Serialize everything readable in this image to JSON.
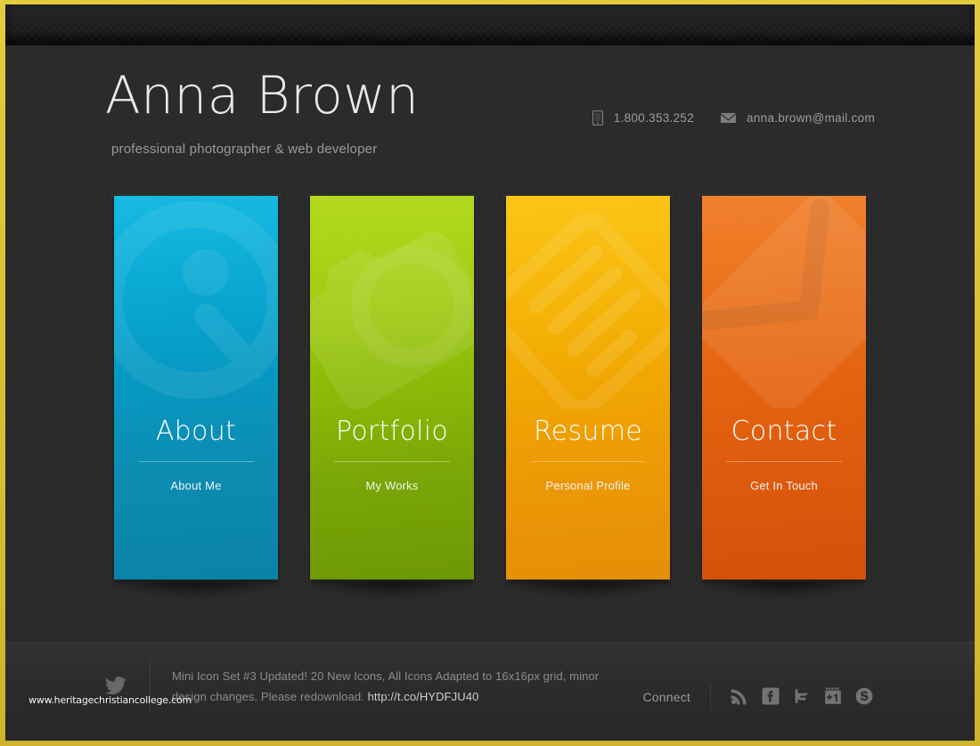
{
  "theme": {
    "frame_color": "#e0c63a",
    "page_bg": "#2b2b2b",
    "topbar_bg": "#1a1a1a",
    "footer_bg": "#2e2e2e"
  },
  "header": {
    "name": "Anna Brown",
    "tagline": "professional photographer & web developer",
    "contacts": [
      {
        "icon": "phone-icon",
        "text": "1.800.353.252"
      },
      {
        "icon": "mail-icon",
        "text": "anna.brown@mail.com"
      }
    ]
  },
  "cards": [
    {
      "title": "About",
      "subtitle": "About Me",
      "watermark_icon": "user-circle-icon",
      "color_top": "#00a8d8",
      "color_bottom": "#0a87ad",
      "accent": "#00a8d8"
    },
    {
      "title": "Portfolio",
      "subtitle": "My Works",
      "watermark_icon": "camera-icon",
      "color_top": "#a4cf09",
      "color_bottom": "#6f9a07",
      "accent": "#a4cf09"
    },
    {
      "title": "Resume",
      "subtitle": "Personal Profile",
      "watermark_icon": "document-lines-icon",
      "color_top": "#f5b400",
      "color_bottom": "#e8940b",
      "accent": "#f5b400"
    },
    {
      "title": "Contact",
      "subtitle": "Get In Touch",
      "watermark_icon": "envelope-icon",
      "color_top": "#ea6a12",
      "color_bottom": "#d8540c",
      "accent": "#ea6a12"
    }
  ],
  "footer": {
    "twitter_icon": "twitter-bird-icon",
    "tweet": "Mini Icon Set #3 Updated! 20 New Icons, All Icons Adapted to 16x16px grid, minor design changes. Please redownload. ",
    "tweet_link": "http://t.co/HYDFJU40",
    "connect_label": "Connect",
    "social": [
      {
        "name": "rss-icon",
        "label": "RSS"
      },
      {
        "name": "facebook-icon",
        "label": "Facebook"
      },
      {
        "name": "twitter-icon",
        "label": "Twitter"
      },
      {
        "name": "google-plus-one-icon",
        "label": "+1"
      },
      {
        "name": "skype-icon",
        "label": "Skype"
      }
    ]
  },
  "watermark": {
    "text": "www.heritagechristiancollege.com"
  }
}
